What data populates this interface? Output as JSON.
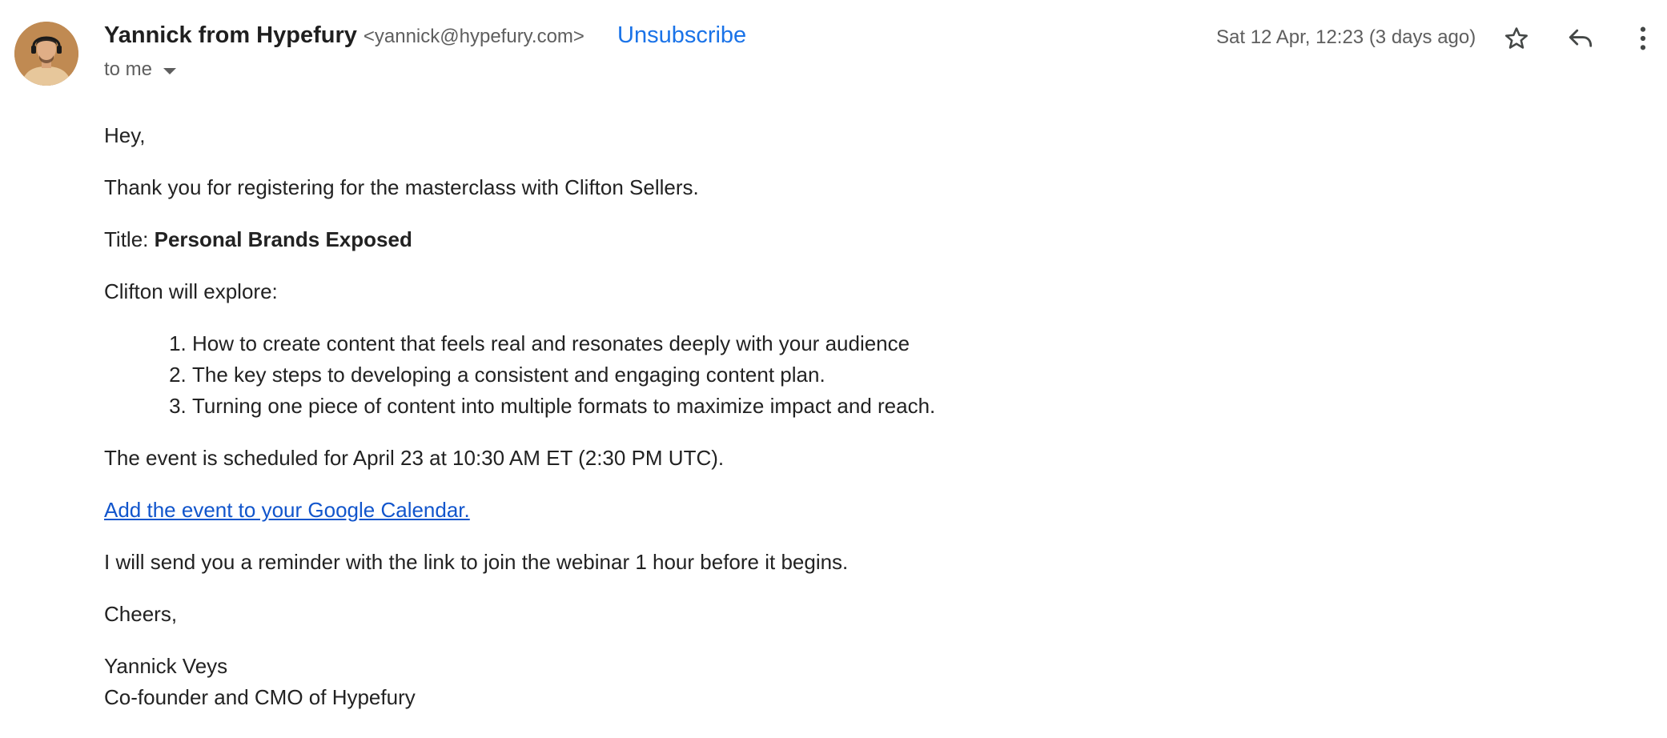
{
  "sender": {
    "name": "Yannick from Hypefury",
    "email": "<yannick@hypefury.com>"
  },
  "unsubscribe_label": "Unsubscribe",
  "recipient_label": "to me",
  "date": "Sat 12 Apr, 12:23 (3 days ago)",
  "icons": {
    "avatar": "avatar-photo",
    "star": "star-icon",
    "reply": "reply-icon",
    "more": "more-vert-icon",
    "caret": "chevron-down-icon"
  },
  "colors": {
    "link": "#1155cc",
    "unsubscribe": "#1a73e8",
    "meta_text": "#5e5e5e"
  },
  "body": {
    "greeting": "Hey,",
    "intro": "Thank you for registering for the masterclass with Clifton Sellers.",
    "title_label": "Title: ",
    "title_value": "Personal Brands Exposed",
    "explore_intro": "Clifton will explore:",
    "topics": [
      "How to create content that feels real and resonates deeply with your audience",
      "The key steps to developing a consistent and engaging content plan.",
      "Turning one piece of content into multiple formats to maximize impact and reach."
    ],
    "schedule": "The event is scheduled for April 23 at 10:30 AM ET (2:30 PM UTC).",
    "calendar_link": "Add the event to your Google Calendar.",
    "reminder": "I will send you a reminder with the link to join the webinar 1 hour before it begins.",
    "closing": "Cheers,",
    "signature_name": "Yannick Veys",
    "signature_title": "Co-founder and CMO of Hypefury"
  }
}
